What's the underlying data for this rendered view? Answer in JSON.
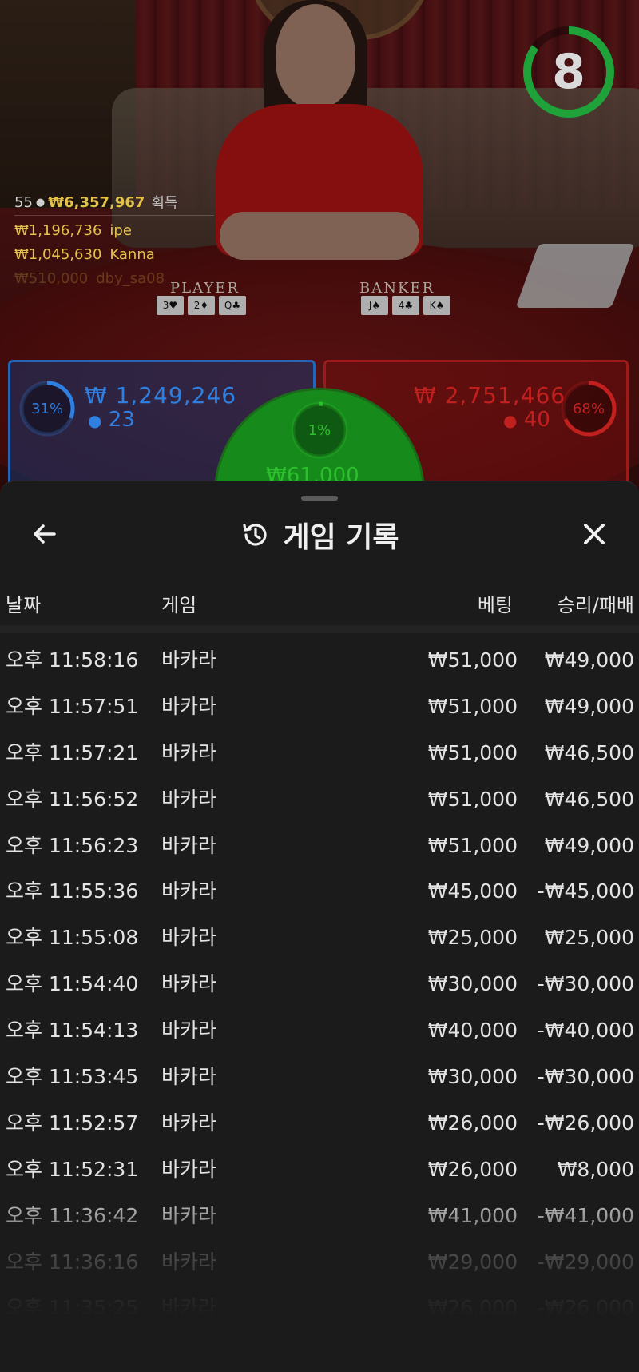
{
  "live": {
    "timer": "8",
    "timer_progress": 0.85,
    "winners": {
      "count": "55",
      "total": "₩6,357,967",
      "total_label": "획득",
      "list": [
        {
          "amount": "₩1,196,736",
          "name": "ipe"
        },
        {
          "amount": "₩1,045,630",
          "name": "Kanna"
        },
        {
          "amount": "₩510,000",
          "name": "dby_sa08"
        }
      ]
    },
    "player_label": "PLAYER",
    "banker_label": "BANKER",
    "player_cards": [
      "3♥",
      "2♦",
      "Q♣"
    ],
    "banker_cards": [
      "J♠",
      "4♣",
      "K♠"
    ],
    "player_bet": {
      "percent": "31%",
      "percent_value": 0.31,
      "amount": "₩ 1,249,246",
      "players": "23"
    },
    "banker_bet": {
      "percent": "68%",
      "percent_value": 0.68,
      "amount": "₩ 2,751,466",
      "players": "40"
    },
    "tie_bet": {
      "percent": "1%",
      "percent_value": 0.01,
      "amount": "₩61,000"
    },
    "colors": {
      "player": "#2f7fe0",
      "banker": "#c0201e",
      "tie": "#2cc02c",
      "timer": "#1fa23a"
    }
  },
  "sheet": {
    "title": "게임 기록",
    "columns": {
      "date": "날짜",
      "game": "게임",
      "bet": "베팅",
      "result": "승리/패배"
    },
    "rows": [
      {
        "date": "오후 11:58:16",
        "game": "바카라",
        "bet": "₩51,000",
        "result": "₩49,000"
      },
      {
        "date": "오후 11:57:51",
        "game": "바카라",
        "bet": "₩51,000",
        "result": "₩49,000"
      },
      {
        "date": "오후 11:57:21",
        "game": "바카라",
        "bet": "₩51,000",
        "result": "₩46,500"
      },
      {
        "date": "오후 11:56:52",
        "game": "바카라",
        "bet": "₩51,000",
        "result": "₩46,500"
      },
      {
        "date": "오후 11:56:23",
        "game": "바카라",
        "bet": "₩51,000",
        "result": "₩49,000"
      },
      {
        "date": "오후 11:55:36",
        "game": "바카라",
        "bet": "₩45,000",
        "result": "-₩45,000"
      },
      {
        "date": "오후 11:55:08",
        "game": "바카라",
        "bet": "₩25,000",
        "result": "₩25,000"
      },
      {
        "date": "오후 11:54:40",
        "game": "바카라",
        "bet": "₩30,000",
        "result": "-₩30,000"
      },
      {
        "date": "오후 11:54:13",
        "game": "바카라",
        "bet": "₩40,000",
        "result": "-₩40,000"
      },
      {
        "date": "오후 11:53:45",
        "game": "바카라",
        "bet": "₩30,000",
        "result": "-₩30,000"
      },
      {
        "date": "오후 11:52:57",
        "game": "바카라",
        "bet": "₩26,000",
        "result": "-₩26,000"
      },
      {
        "date": "오후 11:52:31",
        "game": "바카라",
        "bet": "₩26,000",
        "result": "₩8,000"
      },
      {
        "date": "오후 11:36:42",
        "game": "바카라",
        "bet": "₩41,000",
        "result": "-₩41,000"
      },
      {
        "date": "오후 11:36:16",
        "game": "바카라",
        "bet": "₩29,000",
        "result": "-₩29,000"
      },
      {
        "date": "오후 11:35:25",
        "game": "바카라",
        "bet": "₩26,000",
        "result": "-₩26,000"
      }
    ],
    "icons": {
      "back": "arrow-left-icon",
      "history": "history-icon",
      "close": "close-icon"
    }
  }
}
